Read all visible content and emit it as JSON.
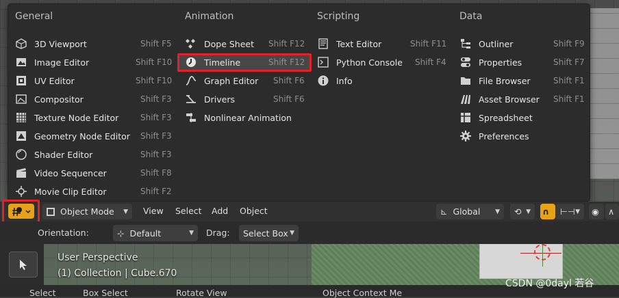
{
  "menu": {
    "columns": [
      {
        "title": "General",
        "items": [
          {
            "label": "3D Viewport",
            "shortcut": "Shift F5",
            "icon": "cube-icon"
          },
          {
            "label": "Image Editor",
            "shortcut": "Shift F10",
            "icon": "image-icon"
          },
          {
            "label": "UV Editor",
            "shortcut": "Shift F10",
            "icon": "uv-icon"
          },
          {
            "label": "Compositor",
            "shortcut": "Shift F3",
            "icon": "compositor-icon"
          },
          {
            "label": "Texture Node Editor",
            "shortcut": "Shift F3",
            "icon": "texture-icon"
          },
          {
            "label": "Geometry Node Editor",
            "shortcut": "Shift F3",
            "icon": "geometry-nodes-icon"
          },
          {
            "label": "Shader Editor",
            "shortcut": "Shift F3",
            "icon": "shader-icon"
          },
          {
            "label": "Video Sequencer",
            "shortcut": "Shift F8",
            "icon": "sequencer-icon"
          },
          {
            "label": "Movie Clip Editor",
            "shortcut": "Shift F2",
            "icon": "movie-clip-icon"
          }
        ]
      },
      {
        "title": "Animation",
        "items": [
          {
            "label": "Dope Sheet",
            "shortcut": "Shift F12",
            "icon": "dope-sheet-icon"
          },
          {
            "label": "Timeline",
            "shortcut": "Shift F12",
            "icon": "timeline-icon"
          },
          {
            "label": "Graph Editor",
            "shortcut": "Shift F6",
            "icon": "graph-icon"
          },
          {
            "label": "Drivers",
            "shortcut": "Shift F6",
            "icon": "drivers-icon"
          },
          {
            "label": "Nonlinear Animation",
            "shortcut": "",
            "icon": "nla-icon"
          }
        ]
      },
      {
        "title": "Scripting",
        "items": [
          {
            "label": "Text Editor",
            "shortcut": "Shift F11",
            "icon": "text-editor-icon"
          },
          {
            "label": "Python Console",
            "shortcut": "Shift F4",
            "icon": "console-icon"
          },
          {
            "label": "Info",
            "shortcut": "",
            "icon": "info-icon"
          }
        ]
      },
      {
        "title": "Data",
        "items": [
          {
            "label": "Outliner",
            "shortcut": "Shift F9",
            "icon": "outliner-icon"
          },
          {
            "label": "Properties",
            "shortcut": "Shift F7",
            "icon": "properties-icon"
          },
          {
            "label": "File Browser",
            "shortcut": "Shift F1",
            "icon": "folder-icon"
          },
          {
            "label": "Asset Browser",
            "shortcut": "Shift F1",
            "icon": "asset-icon"
          },
          {
            "label": "Spreadsheet",
            "shortcut": "",
            "icon": "spreadsheet-icon"
          },
          {
            "label": "Preferences",
            "shortcut": "",
            "icon": "gear-icon"
          }
        ]
      }
    ]
  },
  "header": {
    "mode": "Object Mode",
    "menus": [
      "View",
      "Select",
      "Add",
      "Object"
    ],
    "transform_orientation": "Global"
  },
  "toolbar": {
    "orientation_label": "Orientation:",
    "orientation_value": "Default",
    "drag_label": "Drag:",
    "drag_value": "Select Box"
  },
  "viewport": {
    "perspective": "User Perspective",
    "collection": "(1) Collection | Cube.670"
  },
  "statusbar": {
    "items": [
      "Select",
      "Box Select",
      "Rotate View",
      "Object Context Me"
    ]
  },
  "watermark": "CSDN @0dayl 若谷",
  "colors": {
    "highlight": "#e0222b",
    "editor_type_button": "#e8a21a",
    "menu_bg": "#2c2c2c"
  }
}
